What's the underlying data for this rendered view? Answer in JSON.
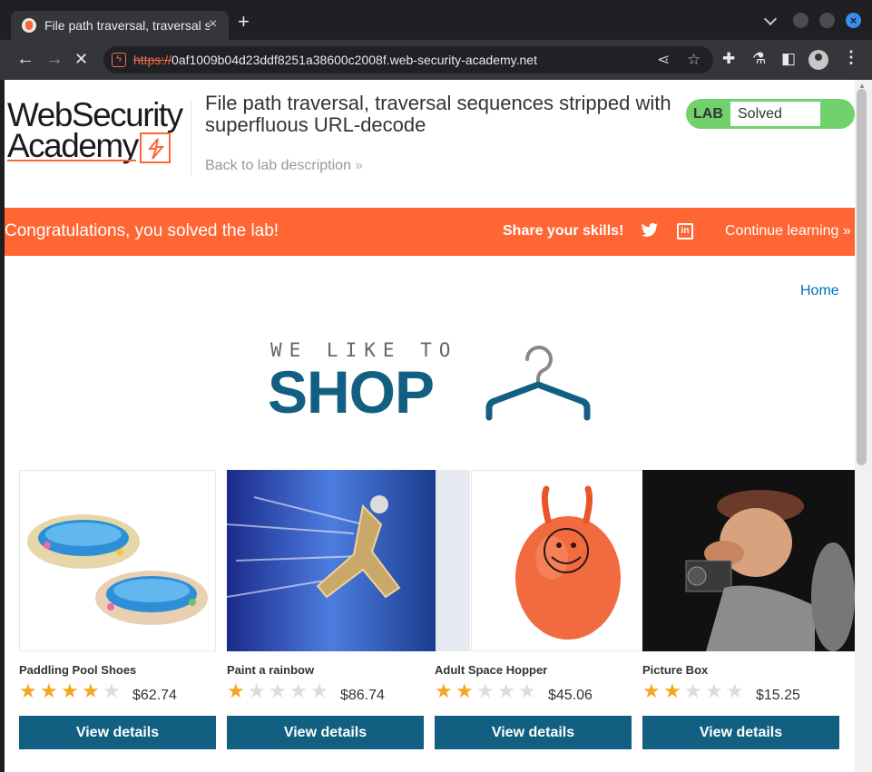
{
  "browser": {
    "tab_title": "File path traversal, traversal sequences stripped with superfluous URL-decode",
    "tab_close": "×",
    "new_tab": "+",
    "url_scheme": "https://",
    "url_host": "0af1009b04d23ddf8251a38600c2008f.web-security-academy.net",
    "window_close": "×"
  },
  "header": {
    "logo_line1": "WebSecurity",
    "logo_line2": "Academy",
    "lab_title": "File path traversal, traversal sequences stripped with superfluous URL-decode",
    "back_link": "Back to lab description",
    "back_arrow": "»",
    "lab_label": "LAB",
    "lab_status": "Solved"
  },
  "banner": {
    "message": "Congratulations, you solved the lab!",
    "share": "Share your skills!",
    "linkedin_glyph": "in",
    "continue": "Continue learning",
    "continue_arrow": "»"
  },
  "nav": {
    "home": "Home"
  },
  "shop_logo": {
    "tagline": "WE LIKE TO",
    "word": "SHOP"
  },
  "products": [
    {
      "name": "Paddling Pool Shoes",
      "price": "$62.74",
      "rating": 4,
      "button": "View details"
    },
    {
      "name": "Paint a rainbow",
      "price": "$86.74",
      "rating": 1,
      "button": "View details"
    },
    {
      "name": "Adult Space Hopper",
      "price": "$45.06",
      "rating": 2,
      "button": "View details"
    },
    {
      "name": "Picture Box",
      "price": "$15.25",
      "rating": 2,
      "button": "View details"
    }
  ],
  "colors": {
    "accent_orange": "#ff6633",
    "lab_solved_green": "#70d16d",
    "button_blue": "#135f82",
    "link_blue": "#0071bc"
  }
}
